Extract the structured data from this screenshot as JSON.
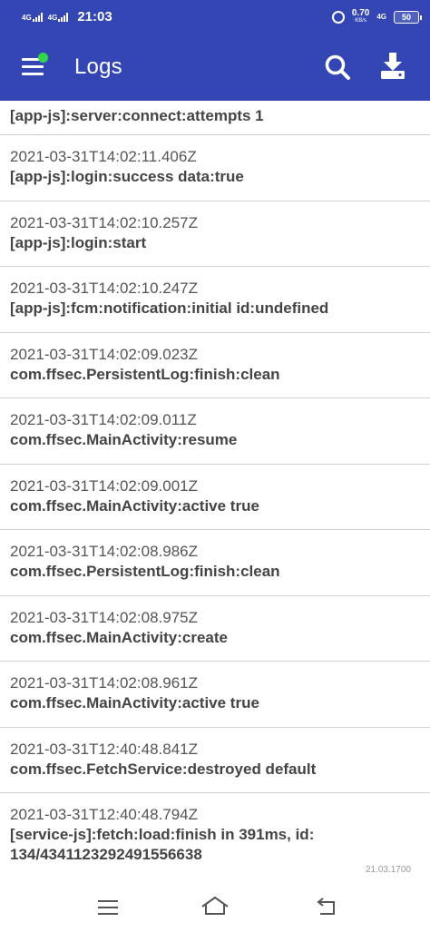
{
  "status_bar": {
    "net1": "4G",
    "net2": "4G",
    "time": "21:03",
    "speed_value": "0.70",
    "speed_unit": "KB/s",
    "net3": "4G",
    "battery": "50"
  },
  "app_bar": {
    "title": "Logs",
    "icons": [
      "menu-icon",
      "search-icon",
      "download-icon"
    ],
    "accent_color": "#3346b4",
    "notification_dot_color": "#32d74b"
  },
  "logs": {
    "partial_message": "[app-js]:server:connect:attempts 1",
    "entries": [
      {
        "timestamp": "2021-03-31T14:02:11.406Z",
        "message": "[app-js]:login:success data:true"
      },
      {
        "timestamp": "2021-03-31T14:02:10.257Z",
        "message": "[app-js]:login:start"
      },
      {
        "timestamp": "2021-03-31T14:02:10.247Z",
        "message": "[app-js]:fcm:notification:initial id:undefined"
      },
      {
        "timestamp": "2021-03-31T14:02:09.023Z",
        "message": "com.ffsec.PersistentLog:finish:clean"
      },
      {
        "timestamp": "2021-03-31T14:02:09.011Z",
        "message": "com.ffsec.MainActivity:resume"
      },
      {
        "timestamp": "2021-03-31T14:02:09.001Z",
        "message": "com.ffsec.MainActivity:active true"
      },
      {
        "timestamp": "2021-03-31T14:02:08.986Z",
        "message": "com.ffsec.PersistentLog:finish:clean"
      },
      {
        "timestamp": "2021-03-31T14:02:08.975Z",
        "message": "com.ffsec.MainActivity:create"
      },
      {
        "timestamp": "2021-03-31T14:02:08.961Z",
        "message": "com.ffsec.MainActivity:active true"
      },
      {
        "timestamp": "2021-03-31T12:40:48.841Z",
        "message": "com.ffsec.FetchService:destroyed default"
      },
      {
        "timestamp": "2021-03-31T12:40:48.794Z",
        "message": "[service-js]:fetch:load:finish in 391ms, id: 134/4341123292491556638"
      }
    ]
  },
  "version": "21.03.1700",
  "nav_bar": {
    "icons": [
      "recent-apps-icon",
      "home-icon",
      "back-icon"
    ]
  }
}
